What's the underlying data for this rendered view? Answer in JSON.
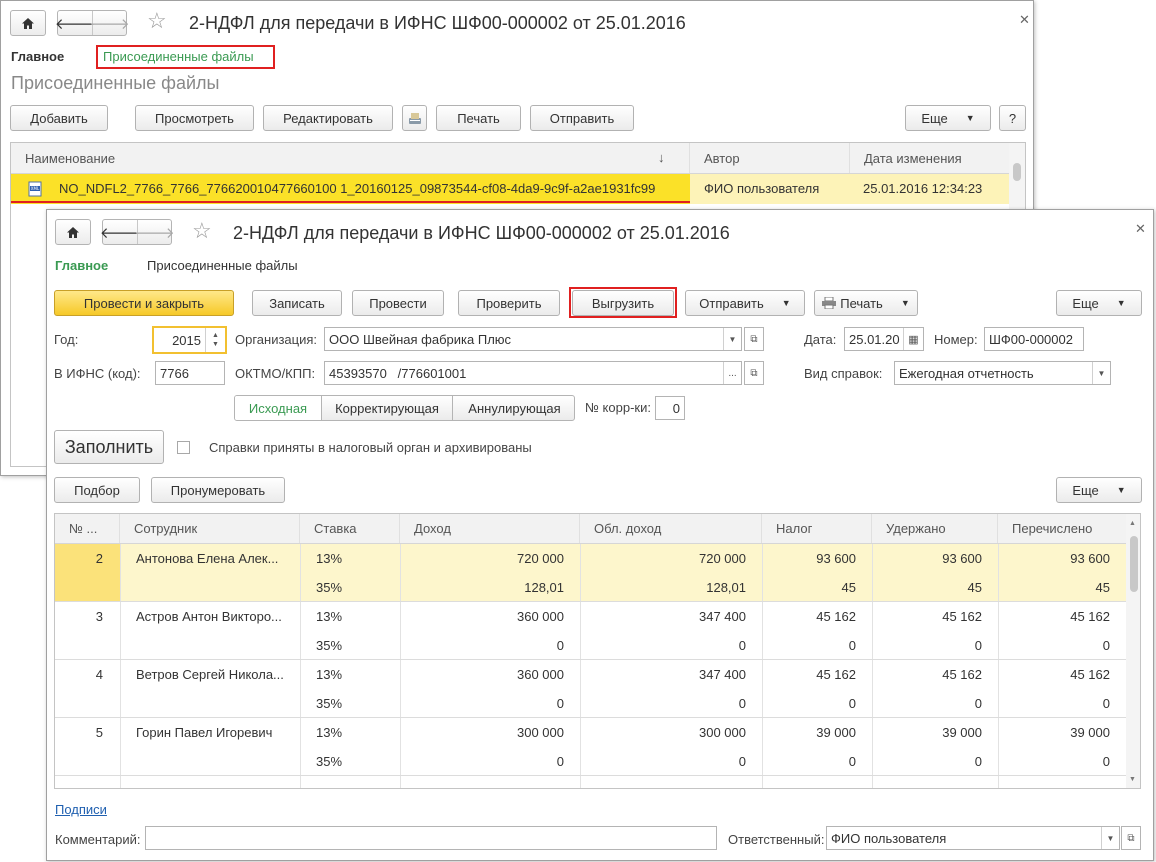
{
  "back_window": {
    "title": "2-НДФЛ для передачи в ИФНС ШФ00-000002 от 25.01.2016",
    "nav_main": "Главное",
    "nav_attached": "Присоединенные файлы",
    "section_title": "Присоединенные файлы",
    "toolbar": {
      "add": "Добавить",
      "view": "Просмотреть",
      "edit": "Редактировать",
      "print": "Печать",
      "send": "Отправить",
      "more": "Еще",
      "help": "?"
    },
    "columns": [
      "Наименование",
      "Автор",
      "Дата изменения"
    ],
    "sort_indicator": "↓",
    "row": {
      "name": "NO_NDFL2_7766_7766_776620010477660100 1_20160125_09873544-cf08-4da9-9c9f-a2ae1931fc99",
      "author": "ФИО пользователя",
      "date": "25.01.2016 12:34:23"
    }
  },
  "front_window": {
    "title": "2-НДФЛ для передачи в ИФНС ШФ00-000002 от 25.01.2016",
    "nav_main": "Главное",
    "nav_attached": "Присоединенные файлы",
    "toolbar": {
      "post_close": "Провести и закрыть",
      "save": "Записать",
      "post": "Провести",
      "check": "Проверить",
      "export": "Выгрузить",
      "send": "Отправить",
      "print": "Печать",
      "more": "Еще"
    },
    "form": {
      "year_label": "Год:",
      "year": "2015",
      "org_label": "Организация:",
      "org": "ООО Швейная фабрика Плюс",
      "date_label": "Дата:",
      "date": "25.01.20",
      "number_label": "Номер:",
      "number": "ШФ00-000002",
      "ifns_label": "В ИФНС (код):",
      "ifns": "7766",
      "oktmo_label": "ОКТМО/КПП:",
      "oktmo": "45393570   /776601001",
      "kind_label": "Вид справок:",
      "kind": "Ежегодная отчетность",
      "seg_initial": "Исходная",
      "seg_correcting": "Корректирующая",
      "seg_cancel": "Аннулирующая",
      "corr_label": "№ корр-ки:",
      "corr": "0",
      "fill": "Заполнить",
      "accepted_label": "Справки приняты в налоговый орган и архивированы"
    },
    "table_toolbar": {
      "select": "Подбор",
      "renumber": "Пронумеровать",
      "more": "Еще"
    },
    "columns": [
      "№ ...",
      "Сотрудник",
      "Ставка",
      "Доход",
      "Обл. доход",
      "Налог",
      "Удержано",
      "Перечислено"
    ],
    "rows": [
      {
        "n": "2",
        "name": "Антонова Елена Алек...",
        "rates": [
          {
            "rate": "13%",
            "income": "720 000",
            "taxable": "720 000",
            "tax": "93 600",
            "withheld": "93 600",
            "paid": "93 600"
          },
          {
            "rate": "35%",
            "income": "128,01",
            "taxable": "128,01",
            "tax": "45",
            "withheld": "45",
            "paid": "45"
          }
        ]
      },
      {
        "n": "3",
        "name": "Астров Антон Викторо...",
        "rates": [
          {
            "rate": "13%",
            "income": "360 000",
            "taxable": "347 400",
            "tax": "45 162",
            "withheld": "45 162",
            "paid": "45 162"
          },
          {
            "rate": "35%",
            "income": "0",
            "taxable": "0",
            "tax": "0",
            "withheld": "0",
            "paid": "0"
          }
        ]
      },
      {
        "n": "4",
        "name": "Ветров Сергей Никола...",
        "rates": [
          {
            "rate": "13%",
            "income": "360 000",
            "taxable": "347 400",
            "tax": "45 162",
            "withheld": "45 162",
            "paid": "45 162"
          },
          {
            "rate": "35%",
            "income": "0",
            "taxable": "0",
            "tax": "0",
            "withheld": "0",
            "paid": "0"
          }
        ]
      },
      {
        "n": "5",
        "name": "Горин Павел Игоревич",
        "rates": [
          {
            "rate": "13%",
            "income": "300 000",
            "taxable": "300 000",
            "tax": "39 000",
            "withheld": "39 000",
            "paid": "39 000"
          },
          {
            "rate": "35%",
            "income": "0",
            "taxable": "0",
            "tax": "0",
            "withheld": "0",
            "paid": "0"
          }
        ]
      }
    ],
    "signatures_link": "Подписи",
    "comment_label": "Комментарий:",
    "comment": "",
    "responsible_label": "Ответственный:",
    "responsible": "ФИО пользователя"
  },
  "colors": {
    "accent_green": "#3a9a52",
    "highlight_yellow": "#fbe128",
    "selected_row": "#fdf6cc",
    "red_box": "#e02020",
    "link_blue": "#2060b0"
  }
}
